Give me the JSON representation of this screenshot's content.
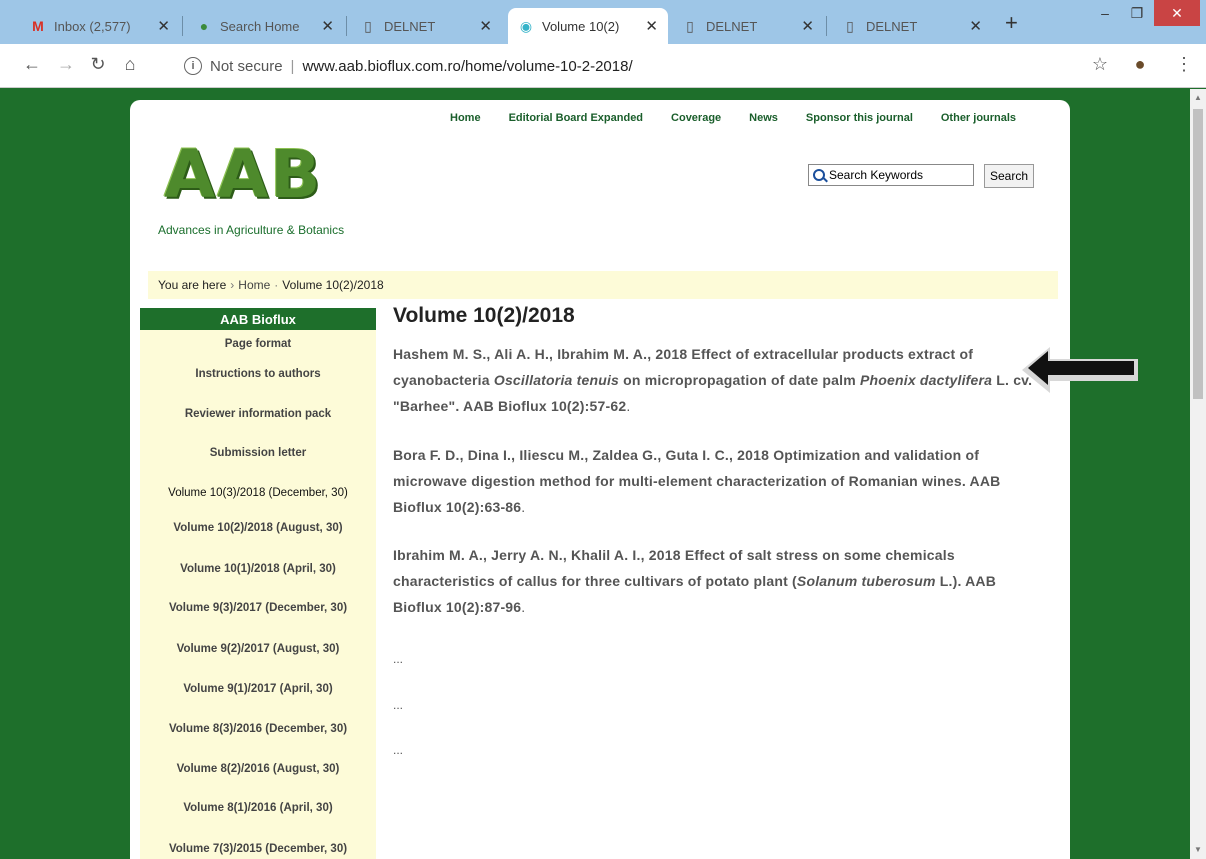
{
  "browser": {
    "tabs": [
      {
        "title": "Inbox (2,577)",
        "icon": "gmail-icon"
      },
      {
        "title": "Search Home",
        "icon": "search-home-icon"
      },
      {
        "title": "DELNET",
        "icon": "page-icon"
      },
      {
        "title": "Volume 10(2)",
        "icon": "bioflux-icon",
        "active": true
      },
      {
        "title": "DELNET",
        "icon": "page-icon"
      },
      {
        "title": "DELNET",
        "icon": "page-icon"
      }
    ],
    "new_tab": "+",
    "address": {
      "security": "Not secure",
      "url": "www.aab.bioflux.com.ro/home/volume-10-2-2018/"
    }
  },
  "header": {
    "nav": [
      "Home",
      "Editorial Board Expanded",
      "Coverage",
      "News",
      "Sponsor this journal",
      "Other journals"
    ],
    "logo_text": "AAB",
    "tagline": "Advances in Agriculture & Botanics",
    "search": {
      "placeholder": "Search Keywords",
      "button": "Search"
    }
  },
  "breadcrumb": {
    "prefix": "You are here",
    "home": "Home",
    "current": "Volume 10(2)/2018"
  },
  "sidebar": {
    "title": "AAB Bioflux",
    "items": [
      "Page format",
      "Instructions to authors",
      "Reviewer information pack",
      "Submission letter",
      "Volume 10(3)/2018 (December, 30)",
      "Volume 10(2)/2018 (August, 30)",
      "Volume 10(1)/2018 (April, 30)",
      "Volume 9(3)/2017 (December, 30)",
      "Volume 9(2)/2017 (August, 30)",
      "Volume 9(1)/2017 (April, 30)",
      "Volume 8(3)/2016 (December, 30)",
      "Volume 8(2)/2016 (August, 30)",
      "Volume 8(1)/2016 (April, 30)",
      "Volume 7(3)/2015 (December, 30)"
    ]
  },
  "main": {
    "title": "Volume 10(2)/2018",
    "refs": [
      {
        "a": "Hashem M. S., Ali A. H., Ibrahim M. A., 2018 Effect of extracellular products extract of cyanobacteria ",
        "i1": "Oscillatoria tenuis",
        "b": " on micropropagation of date palm ",
        "i2": "Phoenix dactylifera",
        "c": " L. cv. \"Barhee\". AAB Bioflux 10(2):57-62",
        "end": "."
      },
      {
        "a": "Bora F. D., Dina I., Iliescu M., Zaldea G., Guta I. C., 2018 Optimization and validation of microwave digestion method for multi-element characterization of Romanian wines. AAB Bioflux 10(2):63-86",
        "end": "."
      },
      {
        "a": "Ibrahim M. A., Jerry A. N., Khalil A. I., 2018 Effect of salt stress on some chemicals characteristics of callus for three cultivars of potato plant (",
        "i1": "Solanum tuberosum",
        "b": " L.). AAB Bioflux 10(2):87-96",
        "end": "."
      }
    ],
    "ellipses": [
      "...",
      "...",
      "..."
    ]
  },
  "colors": {
    "page_bg": "#1e6f2b",
    "accent": "#1a5e2b",
    "sidebar_bg": "#fdfbd8",
    "tab_bar": "#9ec6e7"
  }
}
